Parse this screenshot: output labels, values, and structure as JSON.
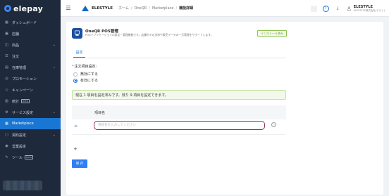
{
  "brand": {
    "logo_text": "elepay"
  },
  "sidebar": {
    "items": [
      {
        "icon": "grid-icon",
        "glyph": "▦",
        "label": "ダッシュボード",
        "chevron": false,
        "badge": ""
      },
      {
        "icon": "store-icon",
        "glyph": "▣",
        "label": "店舗",
        "chevron": false,
        "badge": ""
      },
      {
        "icon": "product-icon",
        "glyph": "◫",
        "label": "商品",
        "chevron": true,
        "badge": ""
      },
      {
        "icon": "order-icon",
        "glyph": "☰",
        "label": "注文",
        "chevron": false,
        "badge": ""
      },
      {
        "icon": "inventory-icon",
        "glyph": "▤",
        "label": "在庫管理",
        "chevron": true,
        "badge": ""
      },
      {
        "icon": "promotion-icon",
        "glyph": "◎",
        "label": "プロモーション",
        "chevron": false,
        "badge": ""
      },
      {
        "icon": "campaign-icon",
        "glyph": "◇",
        "label": "キャンペーン",
        "chevron": false,
        "badge": ""
      },
      {
        "icon": "stats-icon",
        "glyph": "▥",
        "label": "統計",
        "chevron": false,
        "badge": "beta"
      },
      {
        "icon": "service-icon",
        "glyph": "⚙",
        "label": "サービス設定",
        "chevron": true,
        "badge": ""
      },
      {
        "icon": "marketplace-icon",
        "glyph": "▦",
        "label": "Marketplace",
        "chevron": false,
        "badge": "",
        "active": true
      },
      {
        "icon": "contract-icon",
        "glyph": "▢",
        "label": "契約設定",
        "chevron": true,
        "badge": ""
      },
      {
        "icon": "account-icon",
        "glyph": "◉",
        "label": "営業設定",
        "chevron": false,
        "badge": ""
      },
      {
        "icon": "tools-icon",
        "glyph": "✎",
        "label": "ツール",
        "chevron": false,
        "badge": "beta"
      }
    ]
  },
  "header": {
    "brand_name": "ELESTYLE",
    "breadcrumb": [
      "ホーム",
      "OneQR",
      "Marketplace",
      "機能詳細"
    ],
    "user_name": "ELESTYLE",
    "user_sub": "ELESTYLE株式会社(テスト)"
  },
  "app": {
    "title": "OneQR POS管理",
    "description": "POSアプリケーションの設定・管理機能です。店舗内での決済や販売データの一元管理をサポートします。",
    "install_tag": "インストール済み"
  },
  "tabs": [
    {
      "label": "設定"
    }
  ],
  "form": {
    "field_label": "注文項目設定:",
    "options": [
      {
        "label": "無効にする",
        "checked": false
      },
      {
        "label": "有効にする",
        "checked": true
      }
    ],
    "notice": "現在 1 項目を設定済みです。残り 9 項目を設定できます。",
    "column_header": "項目名",
    "item_placeholder": "項目名を入力してください",
    "add_symbol": "+",
    "save_label": "保 存"
  },
  "colors": {
    "sidebar_bg": "#1e2a3b",
    "accent": "#1976d2",
    "input_focus": "#8a2c5e",
    "notice_bg": "#f3f9ea"
  }
}
